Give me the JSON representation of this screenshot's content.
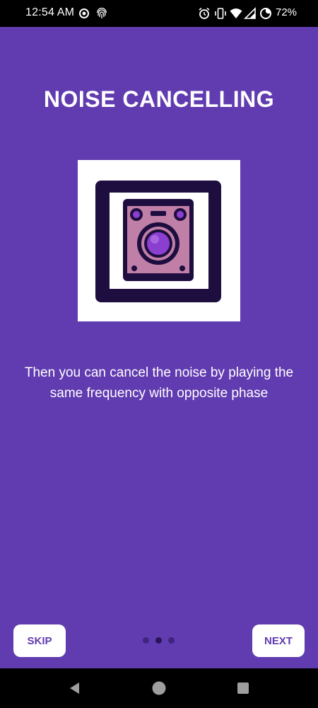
{
  "status_bar": {
    "time": "12:54 AM",
    "battery_percent": "72%",
    "icons": [
      "record-icon",
      "fingerprint-icon",
      "alarm-icon",
      "vibrate-icon",
      "wifi-icon",
      "signal-icon",
      "battery-saver-icon"
    ]
  },
  "onboarding": {
    "title": "NOISE CANCELLING",
    "description": "Then you can cancel the noise by playing the same frequency with opposite phase",
    "illustration_icon": "speaker-icon",
    "page_index": 2,
    "page_count": 3
  },
  "buttons": {
    "skip_label": "SKIP",
    "next_label": "NEXT"
  },
  "nav_bar": {
    "icons": [
      "back-icon",
      "home-icon",
      "recents-icon"
    ]
  },
  "colors": {
    "background": "#613bb0",
    "button_text": "#613bb0",
    "dot_active": "#2a1459",
    "dot_inactive": "#3f2480",
    "speaker_frame": "#1e0d3f",
    "speaker_body": "#c07fa6",
    "speaker_cone": "#8a3fd0"
  }
}
